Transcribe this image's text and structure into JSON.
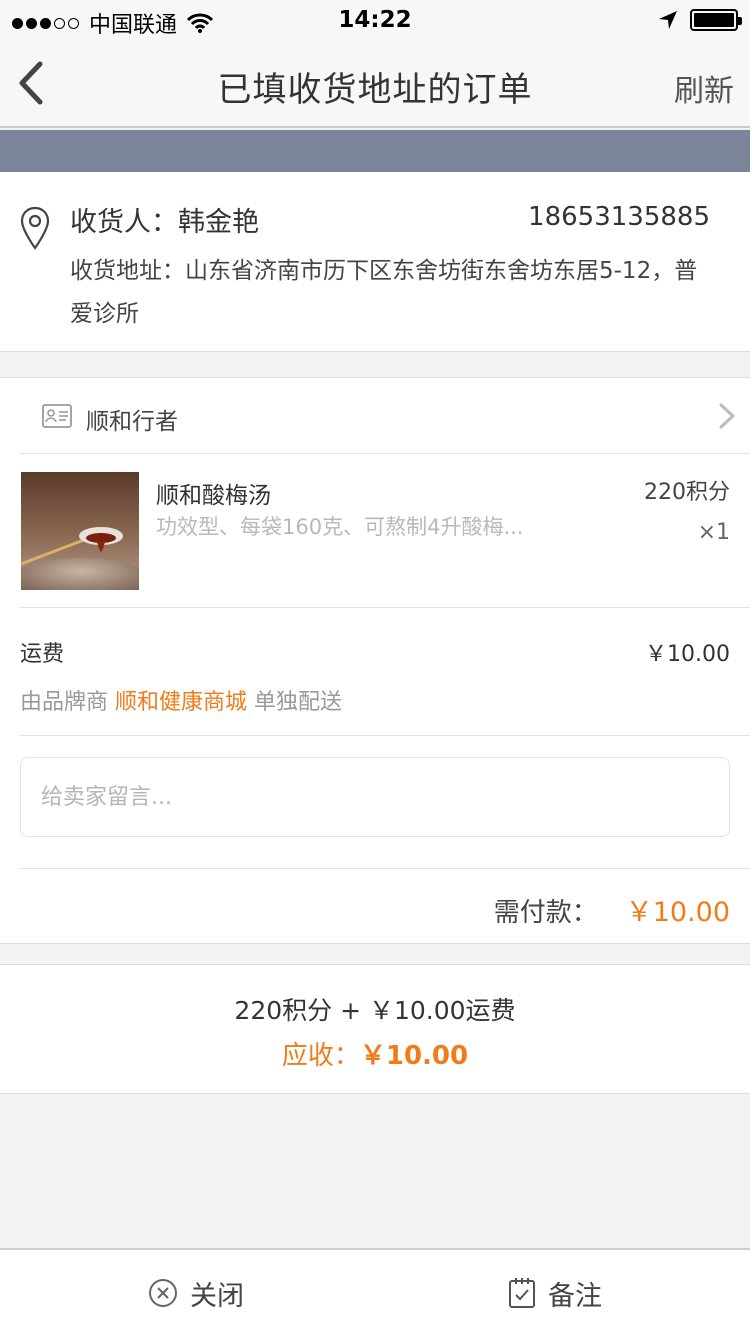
{
  "status_bar": {
    "carrier": "中国联通",
    "time": "14:22",
    "signal_dots_filled": 3,
    "signal_dots_total": 5,
    "battery_level": 1.0
  },
  "nav": {
    "title": "已填收货地址的订单",
    "refresh_label": "刷新"
  },
  "address": {
    "recipient_line": "收货人：韩金艳",
    "phone": "18653135885",
    "address_line": "收货地址：山东省济南市历下区东舍坊街东舍坊东居5-12，普爱诊所"
  },
  "order": {
    "shop_name": "顺和行者",
    "item": {
      "title": "顺和酸梅汤",
      "description": "功效型、每袋160克、可熬制4升酸梅...",
      "points": "220积分",
      "quantity": "×1"
    },
    "shipping": {
      "label": "运费",
      "amount": "￥10.00",
      "by_prefix": "由品牌商",
      "brand": "顺和健康商城",
      "by_suffix": "单独配送"
    },
    "note_placeholder": "给卖家留言...",
    "payable_label": "需付款：",
    "payable_amount": "￥10.00"
  },
  "summary": {
    "line1": "220积分 + ￥10.00运费",
    "receivable_label": "应收：",
    "receivable_amount": "￥10.00"
  },
  "bottom_bar": {
    "close_label": "关闭",
    "remark_label": "备注"
  },
  "colors": {
    "accent": "#f07c1a",
    "banner": "#7b8499"
  },
  "icons": {
    "back": "chevron-left-icon",
    "location": "map-pin-icon",
    "shop": "id-card-icon",
    "chevron": "chevron-right-icon",
    "close": "circle-x-icon",
    "remark": "checklist-icon",
    "wifi": "wifi-icon",
    "location_arrow": "location-arrow-icon",
    "battery": "battery-icon"
  }
}
